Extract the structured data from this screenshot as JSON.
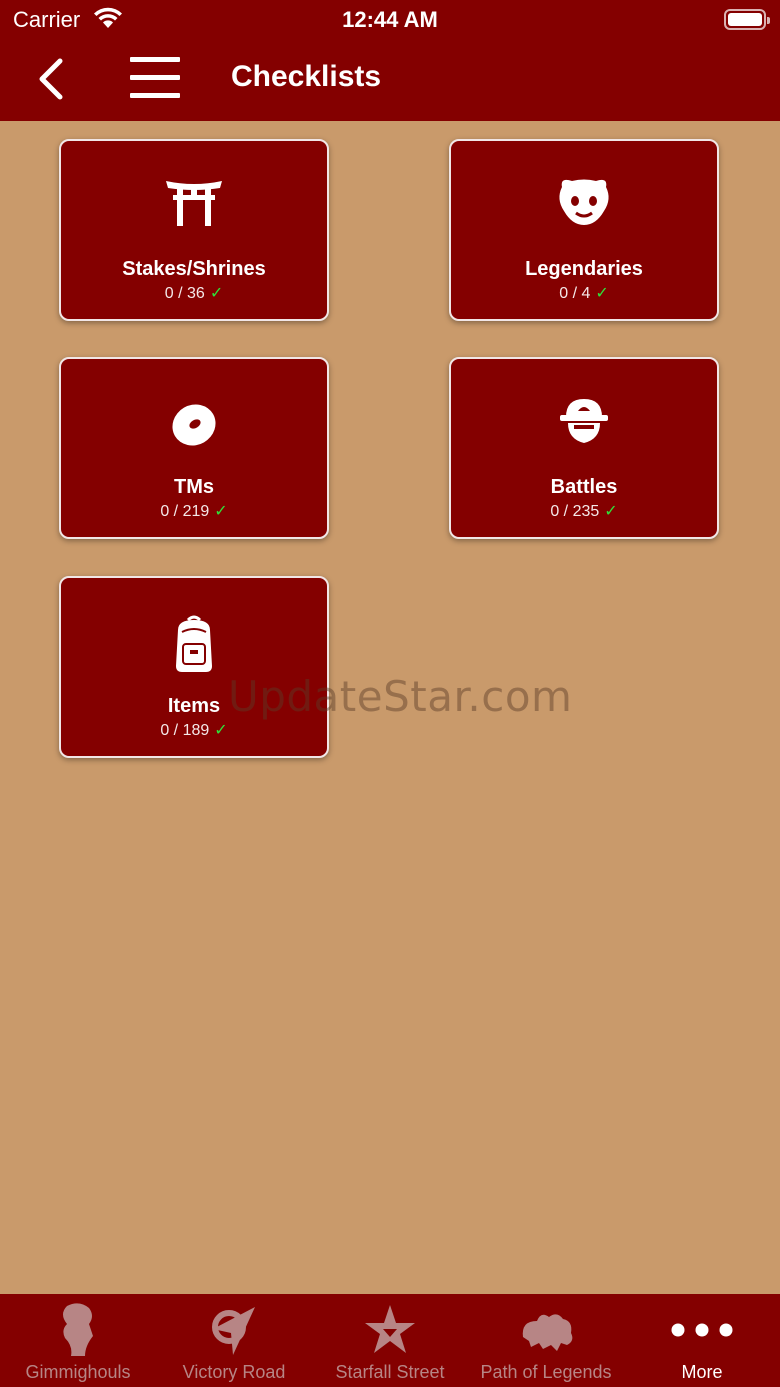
{
  "status": {
    "carrier": "Carrier",
    "time": "12:44 AM"
  },
  "nav": {
    "title": "Checklists"
  },
  "cards": [
    {
      "label": "Stakes/Shrines",
      "count": "0 / 36",
      "check": "✓",
      "icon": "torii-gate-icon"
    },
    {
      "label": "Legendaries",
      "count": "0 / 4",
      "check": "✓",
      "icon": "legendary-pokemon-icon"
    },
    {
      "label": "TMs",
      "count": "0 / 219",
      "check": "✓",
      "icon": "disc-icon"
    },
    {
      "label": "Battles",
      "count": "0 / 235",
      "check": "✓",
      "icon": "trainer-icon"
    },
    {
      "label": "Items",
      "count": "0 / 189",
      "check": "✓",
      "icon": "backpack-icon"
    }
  ],
  "watermark": "UpdateStar.com",
  "tabs": [
    {
      "label": "Gimmighouls",
      "icon": "gimmighoul-icon",
      "active": false
    },
    {
      "label": "Victory Road",
      "icon": "victory-road-icon",
      "active": false
    },
    {
      "label": "Starfall Street",
      "icon": "starfall-street-icon",
      "active": false
    },
    {
      "label": "Path of Legends",
      "icon": "path-of-legends-icon",
      "active": false
    },
    {
      "label": "More",
      "icon": "more-dots-icon",
      "active": true
    }
  ],
  "colors": {
    "primary": "#840000",
    "background": "#c99a6b",
    "check": "#2ee23a",
    "inactive_tab": "#b78585"
  }
}
